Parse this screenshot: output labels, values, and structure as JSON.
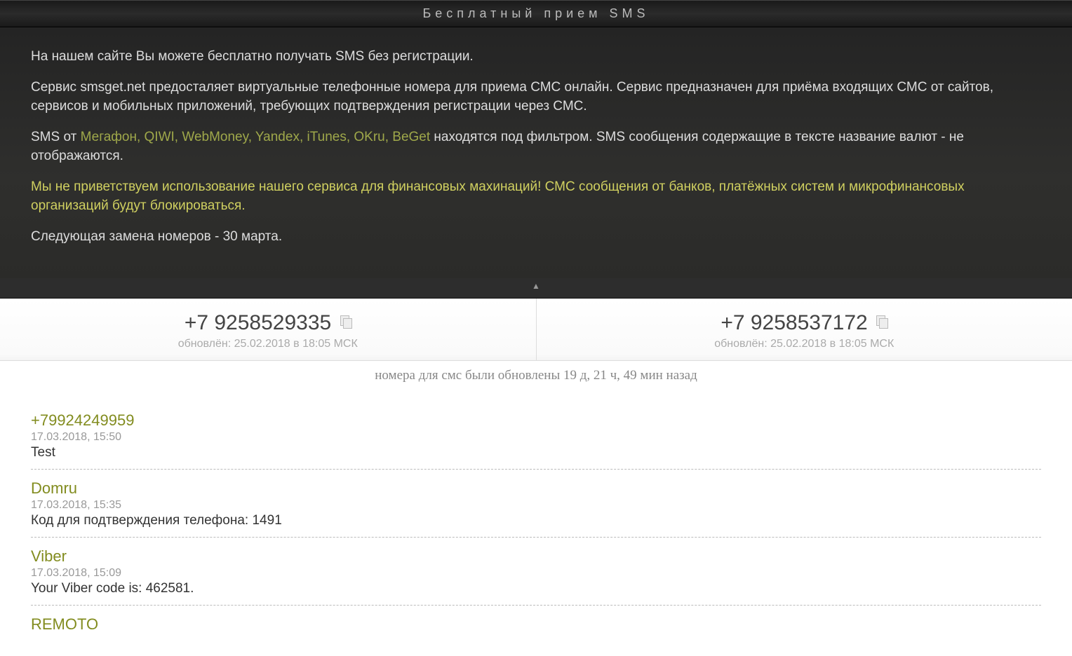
{
  "header": {
    "title": "Бесплатный прием SMS"
  },
  "intro": {
    "p1": "На нашем сайте Вы можете бесплатно получать SMS без регистрации.",
    "p2": "Сервис smsget.net предосталяет виртуальные телефонные номера для приема СМС онлайн. Сервис предназначен для приёма входящих СМС от сайтов, сервисов и мобильных приложений, требующих подтверждения регистрации через СМС.",
    "p3_prefix": "SMS от ",
    "p3_link": "Мегафон, QIWI, WebMoney, Yandex, iTunes, OKru, BeGet",
    "p3_suffix": " находятся под фильтром. SMS сообщения содержащие в тексте название валют - не отображаются.",
    "p4_warning": "Мы не приветствуем использование нашего сервиса для финансовых махинаций! СМС сообщения от банков, платёжных систем и микрофинансовых организаций будут блокироваться.",
    "p5": "Следующая замена номеров - 30 марта."
  },
  "toggle_glyph": "▲",
  "numbers": [
    {
      "phone": "+7 9258529335",
      "updated": "обновлён: 25.02.2018 в 18:05 МСК"
    },
    {
      "phone": "+7 9258537172",
      "updated": "обновлён: 25.02.2018 в 18:05 МСК"
    }
  ],
  "refresh_info": "номера для смс были обновлены 19 д, 21 ч, 49 мин назад",
  "messages": [
    {
      "sender": "+79924249959",
      "time": "17.03.2018, 15:50",
      "body": "Test"
    },
    {
      "sender": "Domru",
      "time": "17.03.2018, 15:35",
      "body": "Код для подтверждения телефона: 1491"
    },
    {
      "sender": "Viber",
      "time": "17.03.2018, 15:09",
      "body": "Your Viber code is: 462581."
    },
    {
      "sender": "REMOTO",
      "time": "",
      "body": ""
    }
  ]
}
